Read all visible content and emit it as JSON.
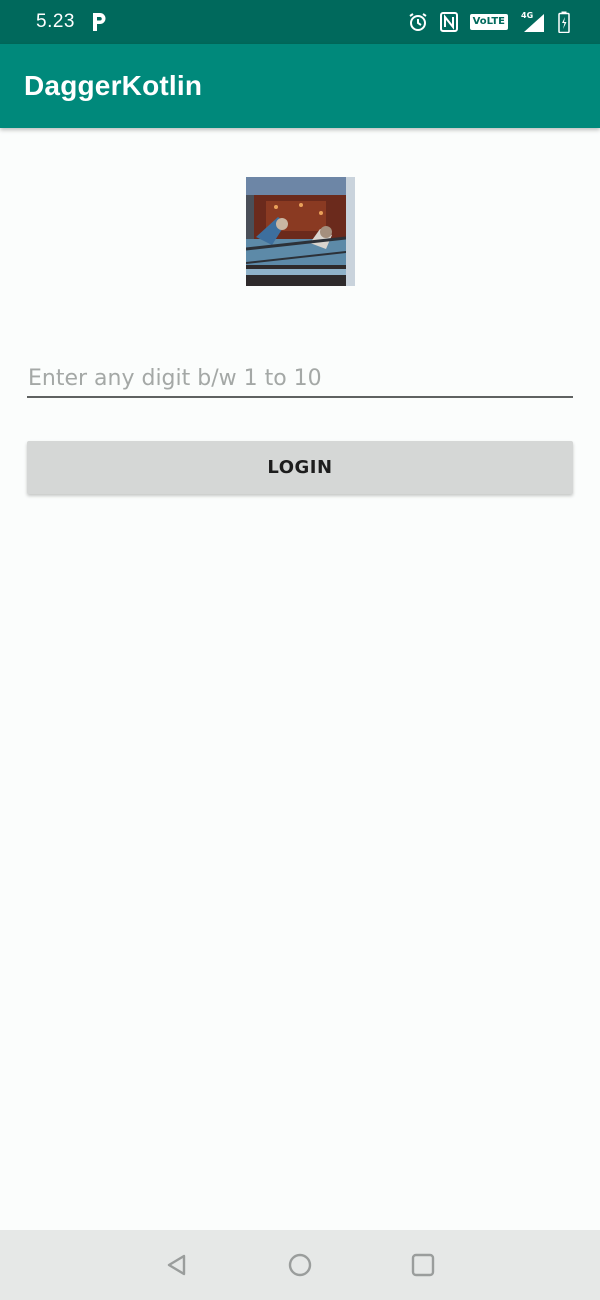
{
  "status_bar": {
    "time": "5.23",
    "carrier_icon": "p-icon",
    "icons": [
      "alarm-icon",
      "nfc-icon",
      "volte-icon",
      "signal-4g-icon",
      "battery-charging-icon"
    ],
    "volte_label": "VoLTE",
    "network_label": "4G"
  },
  "app_bar": {
    "title": "DaggerKotlin"
  },
  "main": {
    "logo_image": "photo-image",
    "input": {
      "value": "",
      "placeholder": "Enter any digit b/w 1 to 10"
    },
    "login_button": {
      "label": "LOGIN"
    }
  },
  "nav_bar": {
    "buttons": [
      "back-icon",
      "home-icon",
      "recents-icon"
    ]
  },
  "colors": {
    "status_bar": "#00695c",
    "app_bar": "#00897b",
    "background": "#fbfdfc",
    "button": "#d5d7d6",
    "nav_bar": "#e6e8e7"
  }
}
